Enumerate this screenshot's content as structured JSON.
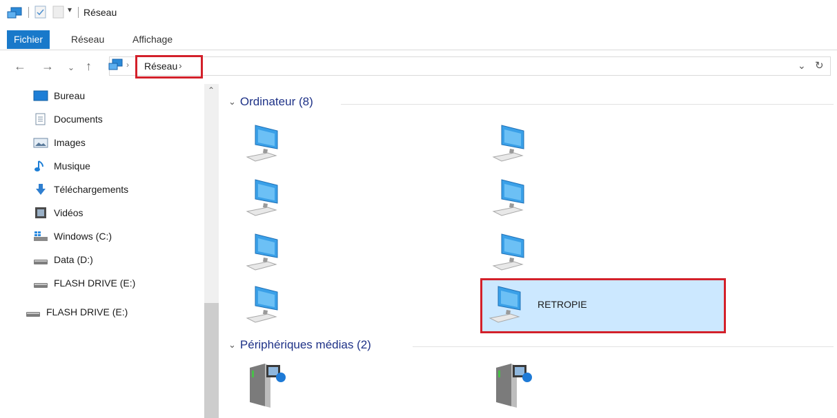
{
  "window": {
    "title": "Réseau"
  },
  "ribbon": {
    "tabs": [
      "Fichier",
      "Réseau",
      "Affichage"
    ]
  },
  "address": {
    "crumb": "Réseau",
    "crumb_sep": "›"
  },
  "sidebar": {
    "items": [
      {
        "label": "Bureau",
        "icon": "desktop-icon"
      },
      {
        "label": "Documents",
        "icon": "documents-icon"
      },
      {
        "label": "Images",
        "icon": "pictures-icon"
      },
      {
        "label": "Musique",
        "icon": "music-icon"
      },
      {
        "label": "Téléchargements",
        "icon": "download-icon"
      },
      {
        "label": "Vidéos",
        "icon": "videos-icon"
      },
      {
        "label": "Windows (C:)",
        "icon": "windows-drive-icon"
      },
      {
        "label": "Data (D:)",
        "icon": "drive-icon"
      },
      {
        "label": "FLASH DRIVE (E:)",
        "icon": "drive-icon"
      }
    ],
    "root_item": {
      "label": "FLASH DRIVE (E:)",
      "icon": "drive-icon"
    }
  },
  "groups": {
    "computers": {
      "header": "Ordinateur (8)",
      "selected_label": "RETROPIE"
    },
    "media": {
      "header": "Périphériques médias (2)"
    }
  },
  "colors": {
    "accent": "#1979ca",
    "highlight": "#d3202a",
    "selection": "#cce8ff",
    "header": "#1e3287"
  }
}
